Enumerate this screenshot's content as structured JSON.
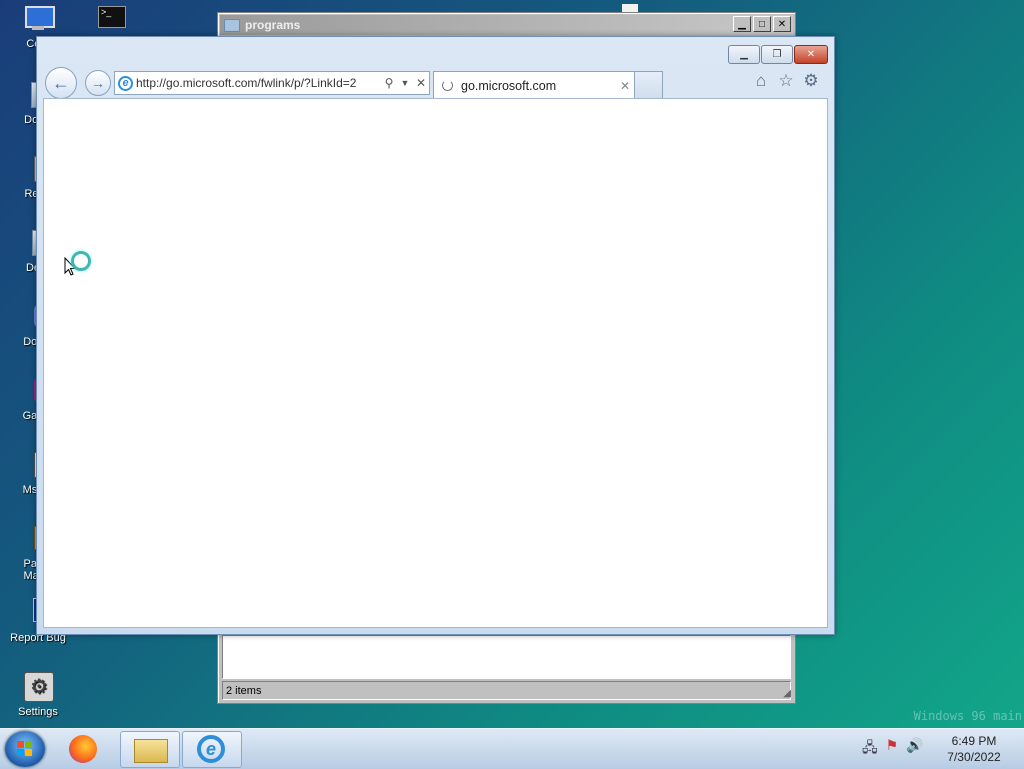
{
  "desktop": {
    "icons": [
      {
        "label": "Com"
      },
      {
        "label": ""
      },
      {
        "label": "Docu"
      },
      {
        "label": "Recy"
      },
      {
        "label": "De"
      },
      {
        "label": "Doc"
      },
      {
        "label": "Gan"
      },
      {
        "label": "Msg"
      },
      {
        "label": "Pac\nMar"
      },
      {
        "label": "Report Bug"
      },
      {
        "label": "Settings"
      }
    ]
  },
  "programs_window": {
    "title": "programs",
    "status": "2 items"
  },
  "ie": {
    "address": "http://go.microsoft.com/fwlink/p/?LinkId=2",
    "tab_title": "go.microsoft.com"
  },
  "watermark": "Windows 96 main",
  "taskbar": {
    "time": "6:49 PM",
    "date": "7/30/2022"
  },
  "colors": {
    "taskbar": "#c9d9ec",
    "desktop_start": "#1a3d7a",
    "desktop_end": "#12a88a"
  }
}
